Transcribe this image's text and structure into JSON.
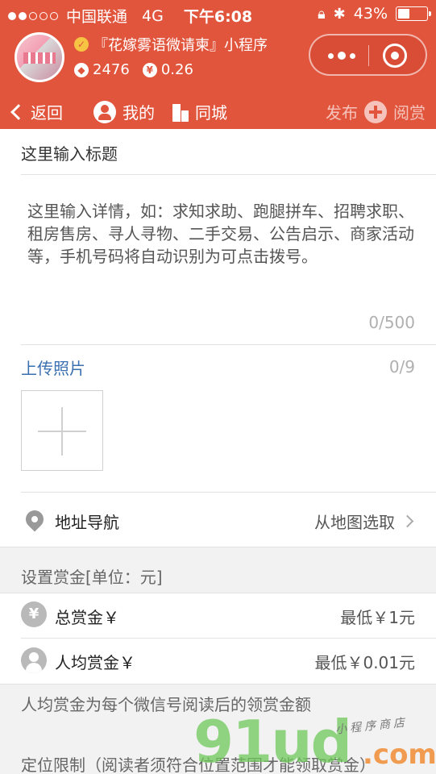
{
  "statusbar": {
    "carrier": "中国联通",
    "network": "4G",
    "time": "下午6:08",
    "battery_text": "43%",
    "battery_level": 0.43
  },
  "header": {
    "app_title": "『花嫁雾语微请柬』小程序",
    "stat1": "2476",
    "stat2": "0.26"
  },
  "nav": {
    "back": "返回",
    "mine": "我的",
    "city": "同城",
    "publish": "发布",
    "reward": "阅赏"
  },
  "form": {
    "title_placeholder": "这里输入标题",
    "detail_placeholder": "这里输入详情，如：求知求助、跑腿拼车、招聘求职、租房售房、寻人寻物、二手交易、公告启示、商家活动等，手机号码将自动识别为可点击拨号。",
    "detail_counter": "0/500",
    "upload_label": "上传照片",
    "upload_counter": "0/9",
    "address_label": "地址导航",
    "address_action": "从地图选取",
    "reward_section": "设置赏金[单位：元]",
    "total_reward_label": "总赏金￥",
    "total_reward_min": "最低￥1元",
    "per_reward_label": "人均赏金￥",
    "per_reward_min": "最低￥0.01元",
    "per_reward_hint": "人均赏金为每个微信号阅读后的领赏金额",
    "location_limit": "定位限制（阅读者须符合位置范围才能领取赏金）"
  },
  "watermark": {
    "main": "91ud",
    "suffix": ".com",
    "sub": "小程序商店"
  },
  "colors": {
    "brand": "#e2553d",
    "link": "#3a6fb0"
  }
}
